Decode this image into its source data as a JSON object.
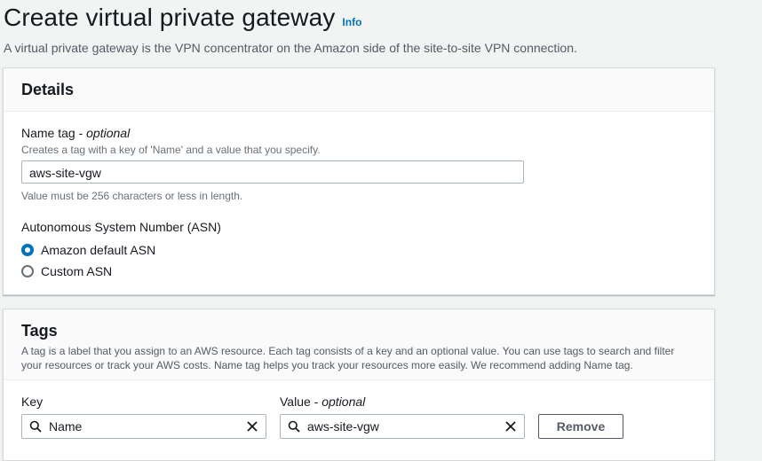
{
  "page": {
    "title": "Create virtual private gateway",
    "info_label": "Info",
    "description": "A virtual private gateway is the VPN concentrator on the Amazon side of the site-to-site VPN connection."
  },
  "details": {
    "heading": "Details",
    "name_tag": {
      "label": "Name tag - ",
      "label_optional": "optional",
      "hint": "Creates a tag with a key of 'Name' and a value that you specify.",
      "value": "aws-site-vgw",
      "constraint": "Value must be 256 characters or less in length."
    },
    "asn": {
      "label": "Autonomous System Number (ASN)",
      "options": [
        {
          "label": "Amazon default ASN",
          "selected": true
        },
        {
          "label": "Custom ASN",
          "selected": false
        }
      ]
    }
  },
  "tags": {
    "heading": "Tags",
    "description": "A tag is a label that you assign to an AWS resource. Each tag consists of a key and an optional value. You can use tags to search and filter your resources or track your AWS costs. Name tag helps you track your resources more easily. We recommend adding Name tag.",
    "key_label": "Key",
    "value_label": "Value - ",
    "value_label_optional": "optional",
    "rows": [
      {
        "key": "Name",
        "value": "aws-site-vgw",
        "remove_label": "Remove"
      }
    ]
  },
  "colors": {
    "accent": "#0073bb",
    "background": "#f2f3f3"
  }
}
